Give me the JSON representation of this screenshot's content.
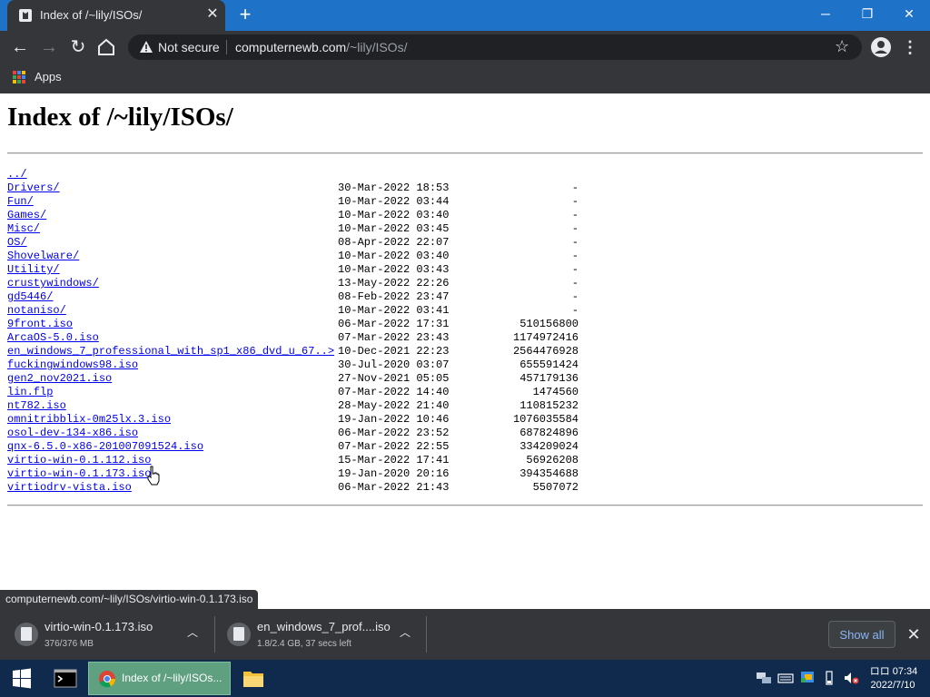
{
  "window": {
    "tab_title": "Index of /~lily/ISOs/",
    "tab_close_glyph": "✕",
    "new_tab_glyph": "+",
    "minimize_glyph": "─",
    "maximize_glyph": "❐",
    "close_glyph": "✕"
  },
  "toolbar": {
    "security_label": "Not secure",
    "url_host": "computernewb.com",
    "url_path": "/~lily/ISOs/",
    "back_glyph": "←",
    "forward_glyph": "→",
    "reload_glyph": "↻",
    "star_glyph": "☆",
    "menu_glyph": "⋮"
  },
  "bookmarks": {
    "apps_label": "Apps"
  },
  "page": {
    "title": "Index of /~lily/ISOs/",
    "entries": [
      {
        "name": "../",
        "date": "",
        "size": ""
      },
      {
        "name": "Drivers/",
        "date": "30-Mar-2022 18:53",
        "size": "-"
      },
      {
        "name": "Fun/",
        "date": "10-Mar-2022 03:44",
        "size": "-"
      },
      {
        "name": "Games/",
        "date": "10-Mar-2022 03:40",
        "size": "-"
      },
      {
        "name": "Misc/",
        "date": "10-Mar-2022 03:45",
        "size": "-"
      },
      {
        "name": "OS/",
        "date": "08-Apr-2022 22:07",
        "size": "-"
      },
      {
        "name": "Shovelware/",
        "date": "10-Mar-2022 03:40",
        "size": "-"
      },
      {
        "name": "Utility/",
        "date": "10-Mar-2022 03:43",
        "size": "-"
      },
      {
        "name": "crustywindows/",
        "date": "13-May-2022 22:26",
        "size": "-"
      },
      {
        "name": "gd5446/",
        "date": "08-Feb-2022 23:47",
        "size": "-"
      },
      {
        "name": "notaniso/",
        "date": "10-Mar-2022 03:41",
        "size": "-"
      },
      {
        "name": "9front.iso",
        "date": "06-Mar-2022 17:31",
        "size": "510156800"
      },
      {
        "name": "ArcaOS-5.0.iso",
        "date": "07-Mar-2022 23:43",
        "size": "1174972416"
      },
      {
        "name": "en_windows_7_professional_with_sp1_x86_dvd_u_67..>",
        "date": "10-Dec-2021 22:23",
        "size": "2564476928"
      },
      {
        "name": "fuckingwindows98.iso",
        "date": "30-Jul-2020 03:07",
        "size": "655591424"
      },
      {
        "name": "gen2_nov2021.iso",
        "date": "27-Nov-2021 05:05",
        "size": "457179136"
      },
      {
        "name": "lin.flp",
        "date": "07-Mar-2022 14:40",
        "size": "1474560"
      },
      {
        "name": "nt782.iso",
        "date": "28-May-2022 21:40",
        "size": "110815232"
      },
      {
        "name": "omnitribblix-0m25lx.3.iso",
        "date": "19-Jan-2022 10:46",
        "size": "1076035584"
      },
      {
        "name": "osol-dev-134-x86.iso",
        "date": "06-Mar-2022 23:52",
        "size": "687824896"
      },
      {
        "name": "qnx-6.5.0-x86-201007091524.iso",
        "date": "07-Mar-2022 22:55",
        "size": "334209024"
      },
      {
        "name": "virtio-win-0.1.112.iso",
        "date": "15-Mar-2022 17:41",
        "size": "56926208"
      },
      {
        "name": "virtio-win-0.1.173.iso",
        "date": "19-Jan-2020 20:16",
        "size": "394354688"
      },
      {
        "name": "virtiodrv-vista.iso",
        "date": "06-Mar-2022 21:43",
        "size": "5507072"
      }
    ]
  },
  "status_bar": {
    "hover_url": "computernewb.com/~lily/ISOs/virtio-win-0.1.173.iso"
  },
  "downloads": {
    "items": [
      {
        "name": "virtio-win-0.1.173.iso",
        "status": "376/376 MB"
      },
      {
        "name": "en_windows_7_prof....iso",
        "status": "1.8/2.4 GB, 37 secs left"
      }
    ],
    "chevron_glyph": "︿",
    "show_all_label": "Show all",
    "close_glyph": "✕"
  },
  "taskbar": {
    "chrome_label": "Index of /~lily/ISOs...",
    "clock_time": "ロロ 07:34",
    "clock_date": "2022/7/10"
  },
  "colors": {
    "titlebar": "#1e73c8",
    "chrome_dark": "#35363a",
    "link": "#0000ee",
    "taskbar": "#0f2a4d",
    "active_task": "#5fa080"
  }
}
